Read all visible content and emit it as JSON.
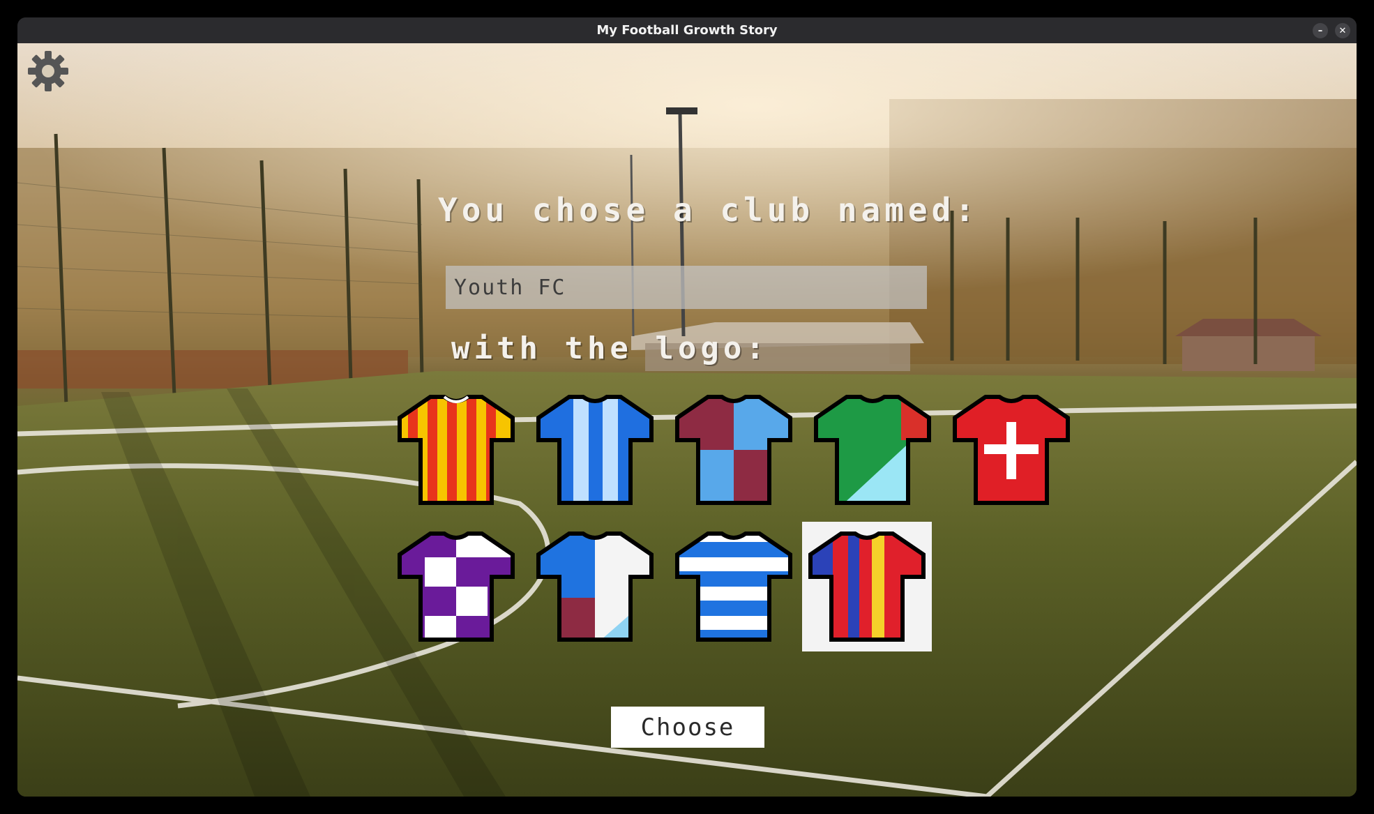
{
  "window": {
    "title": "My Football Growth Story",
    "minimize_symbol": "–",
    "close_symbol": "✕"
  },
  "settings": {
    "icon": "gear-icon"
  },
  "club": {
    "heading": "You chose a club named:",
    "name_value": "Youth FC"
  },
  "logo": {
    "heading": "with the logo:",
    "selected_index": 8,
    "jerseys": [
      {
        "name": "jersey-red-yellow-stripes",
        "colors": [
          "#f7c400",
          "#e8341c"
        ]
      },
      {
        "name": "jersey-blue-white-stripes",
        "colors": [
          "#1f6fe0",
          "#bfe0ff"
        ]
      },
      {
        "name": "jersey-claret-blue-quarters",
        "colors": [
          "#8e2b43",
          "#58a8ea"
        ]
      },
      {
        "name": "jersey-green-cyan-diagonal",
        "colors": [
          "#1e9a45",
          "#9be6f5",
          "#d9302a"
        ]
      },
      {
        "name": "jersey-red-white-cross",
        "colors": [
          "#e01f26",
          "#ffffff"
        ]
      },
      {
        "name": "jersey-purple-white-checks",
        "colors": [
          "#6a1b9a",
          "#ffffff"
        ]
      },
      {
        "name": "jersey-blue-white-claret",
        "colors": [
          "#1f73e0",
          "#ffffff",
          "#8e2b43"
        ]
      },
      {
        "name": "jersey-blue-white-hoops",
        "colors": [
          "#1f73e0",
          "#ffffff"
        ]
      },
      {
        "name": "jersey-red-blue-yellow-stripes",
        "colors": [
          "#e0202b",
          "#2b42b8",
          "#f5d22a"
        ]
      }
    ]
  },
  "actions": {
    "choose_label": "Choose"
  }
}
